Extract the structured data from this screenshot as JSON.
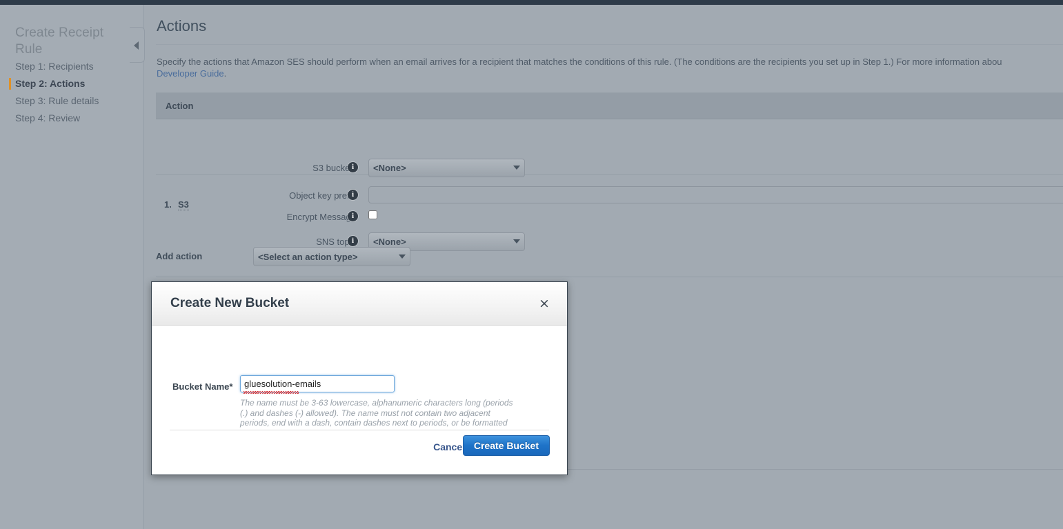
{
  "sidebar": {
    "title": "Create Receipt Rule",
    "steps": [
      {
        "label": "Step 1: Recipients",
        "current": false
      },
      {
        "label": "Step 2: Actions",
        "current": true
      },
      {
        "label": "Step 3: Rule details",
        "current": false
      },
      {
        "label": "Step 4: Review",
        "current": false
      }
    ],
    "collapse_tooltip": "Collapse navigation"
  },
  "main": {
    "page_title": "Actions",
    "description_part1": "Specify the actions that Amazon SES should perform when an email arrives for a recipient that matches the conditions of this rule. (The conditions are the recipients you set up in Step 1.) For more information abou",
    "description_link": "Developer Guide",
    "description_part2": ".",
    "table_header": "Action",
    "action": {
      "index": "1.",
      "type": "S3",
      "fields": {
        "s3_bucket_label": "S3 bucket*",
        "s3_bucket_value": "<None>",
        "object_key_prefix_label": "Object key prefix",
        "object_key_prefix_value": "",
        "encrypt_message_label": "Encrypt Message",
        "encrypt_message_checked": false,
        "sns_topic_label": "SNS topic",
        "sns_topic_value": "<None>"
      }
    },
    "add_action_label": "Add action",
    "add_action_value": "<Select an action type>"
  },
  "modal": {
    "title": "Create New Bucket",
    "close_label": "×",
    "bucket_name_label": "Bucket Name*",
    "bucket_name_value": "gluesolution-emails",
    "bucket_name_placeholder": "",
    "hint": "The name must be 3-63 lowercase, alphanumeric characters long (periods (.) and dashes (-) allowed). The name must not contain two adjacent periods, end with a dash, contain dashes next to periods, or be formatted as an IP address.",
    "cancel_label": "Cancel",
    "create_label": "Create Bucket"
  },
  "colors": {
    "page_background": "#a2aab2",
    "top_chrome": "#2e3b49",
    "accent_orange": "#e09127",
    "link_blue": "#4a6d9c",
    "primary_button_blue": "#1e73c8",
    "input_focus_blue": "#6fa8dc",
    "spellcheck_red": "#e02b2b"
  }
}
